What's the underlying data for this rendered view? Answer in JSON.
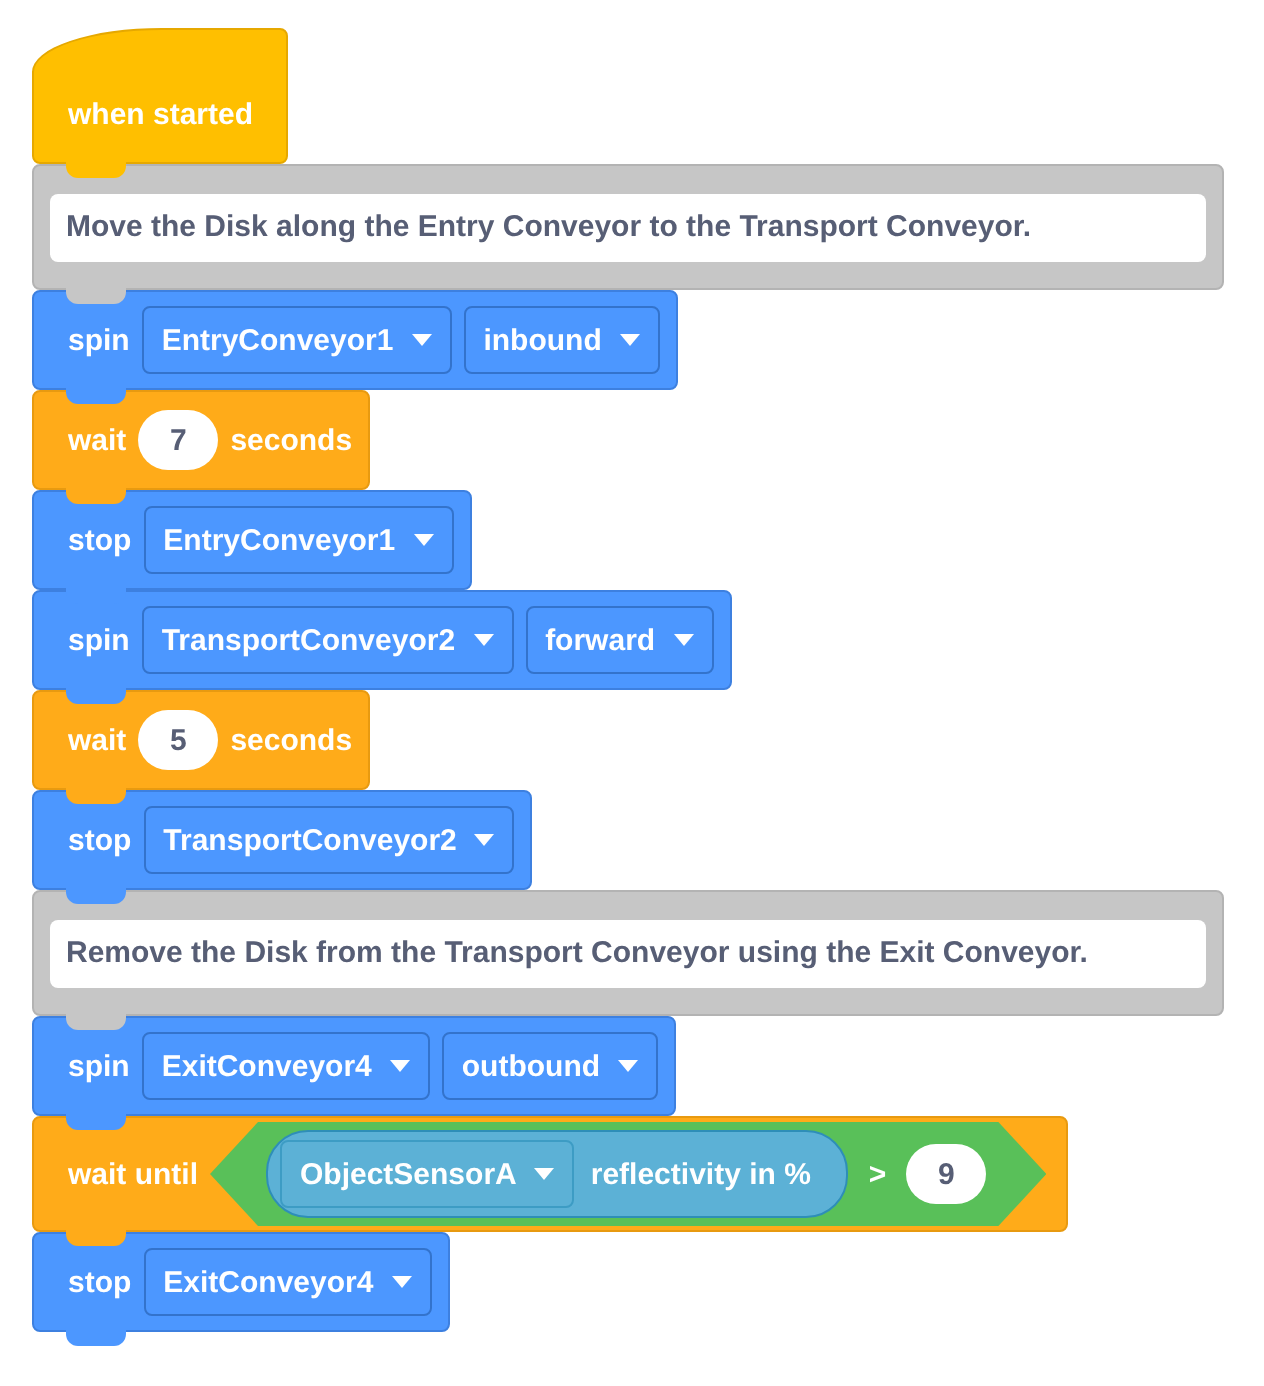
{
  "blocks": [
    {
      "kind": "hat",
      "parts": [
        {
          "kind": "label",
          "text": "when started"
        }
      ]
    },
    {
      "kind": "comment",
      "parts": [
        {
          "kind": "note",
          "text": "Move the Disk along the Entry Conveyor to the Transport Conveyor."
        }
      ]
    },
    {
      "kind": "motion",
      "parts": [
        {
          "kind": "label",
          "text": "spin"
        },
        {
          "kind": "dropdown",
          "text": "EntryConveyor1"
        },
        {
          "kind": "dropdown",
          "text": "inbound"
        }
      ]
    },
    {
      "kind": "control",
      "parts": [
        {
          "kind": "label",
          "text": "wait"
        },
        {
          "kind": "number",
          "text": "7"
        },
        {
          "kind": "label",
          "text": "seconds"
        }
      ]
    },
    {
      "kind": "motion",
      "parts": [
        {
          "kind": "label",
          "text": "stop"
        },
        {
          "kind": "dropdown",
          "text": "EntryConveyor1"
        }
      ]
    },
    {
      "kind": "motion",
      "parts": [
        {
          "kind": "label",
          "text": "spin"
        },
        {
          "kind": "dropdown",
          "text": "TransportConveyor2"
        },
        {
          "kind": "dropdown",
          "text": "forward"
        }
      ]
    },
    {
      "kind": "control",
      "parts": [
        {
          "kind": "label",
          "text": "wait"
        },
        {
          "kind": "number",
          "text": "5"
        },
        {
          "kind": "label",
          "text": "seconds"
        }
      ]
    },
    {
      "kind": "motion",
      "parts": [
        {
          "kind": "label",
          "text": "stop"
        },
        {
          "kind": "dropdown",
          "text": "TransportConveyor2"
        }
      ]
    },
    {
      "kind": "comment",
      "parts": [
        {
          "kind": "note",
          "text": "Remove the Disk from the Transport Conveyor using the Exit Conveyor."
        }
      ]
    },
    {
      "kind": "motion",
      "parts": [
        {
          "kind": "label",
          "text": "spin"
        },
        {
          "kind": "dropdown",
          "text": "ExitConveyor4"
        },
        {
          "kind": "dropdown",
          "text": "outbound"
        }
      ]
    },
    {
      "kind": "control",
      "parts": [
        {
          "kind": "label",
          "text": "wait until"
        },
        {
          "kind": "condition",
          "sensor": "ObjectSensorA",
          "property": "reflectivity in %",
          "operator": ">",
          "value": "9"
        }
      ]
    },
    {
      "kind": "motion",
      "parts": [
        {
          "kind": "label",
          "text": "stop"
        },
        {
          "kind": "dropdown",
          "text": "ExitConveyor4"
        }
      ]
    }
  ]
}
